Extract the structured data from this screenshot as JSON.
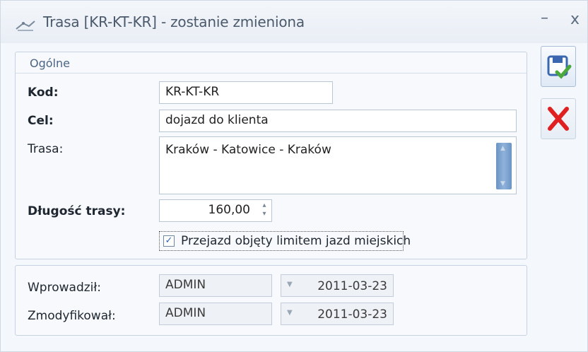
{
  "window": {
    "title": "Trasa [KR-KT-KR] - zostanie zmieniona",
    "minimize_glyph": "–",
    "close_glyph": "x"
  },
  "panel_ogolne": {
    "header": "Ogólne",
    "kod_label": "Kod:",
    "kod_value": "KR-KT-KR",
    "cel_label": "Cel:",
    "cel_value": "dojazd do klienta",
    "trasa_label": "Trasa:",
    "trasa_value": "Kraków - Katowice - Kraków",
    "dlugosc_label": "Długość trasy:",
    "dlugosc_value": "160,00",
    "checkbox_label": "Przejazd objęty limitem jazd miejskich",
    "checkbox_checked": true
  },
  "panel_audit": {
    "wprowadzil_label": "Wprowadził:",
    "wprowadzil_user": "ADMIN",
    "wprowadzil_date": "2011-03-23",
    "zmodyfikowal_label": "Zmodyfikował:",
    "zmodyfikowal_user": "ADMIN",
    "zmodyfikowal_date": "2011-03-23"
  },
  "icons": {
    "app": "route-icon",
    "save": "save-icon",
    "cancel": "cancel-icon"
  },
  "colors": {
    "accent": "#4b6585",
    "save_check": "#4aa83c",
    "cancel_x": "#e02020",
    "scrollbar": "#7aa0cf"
  }
}
